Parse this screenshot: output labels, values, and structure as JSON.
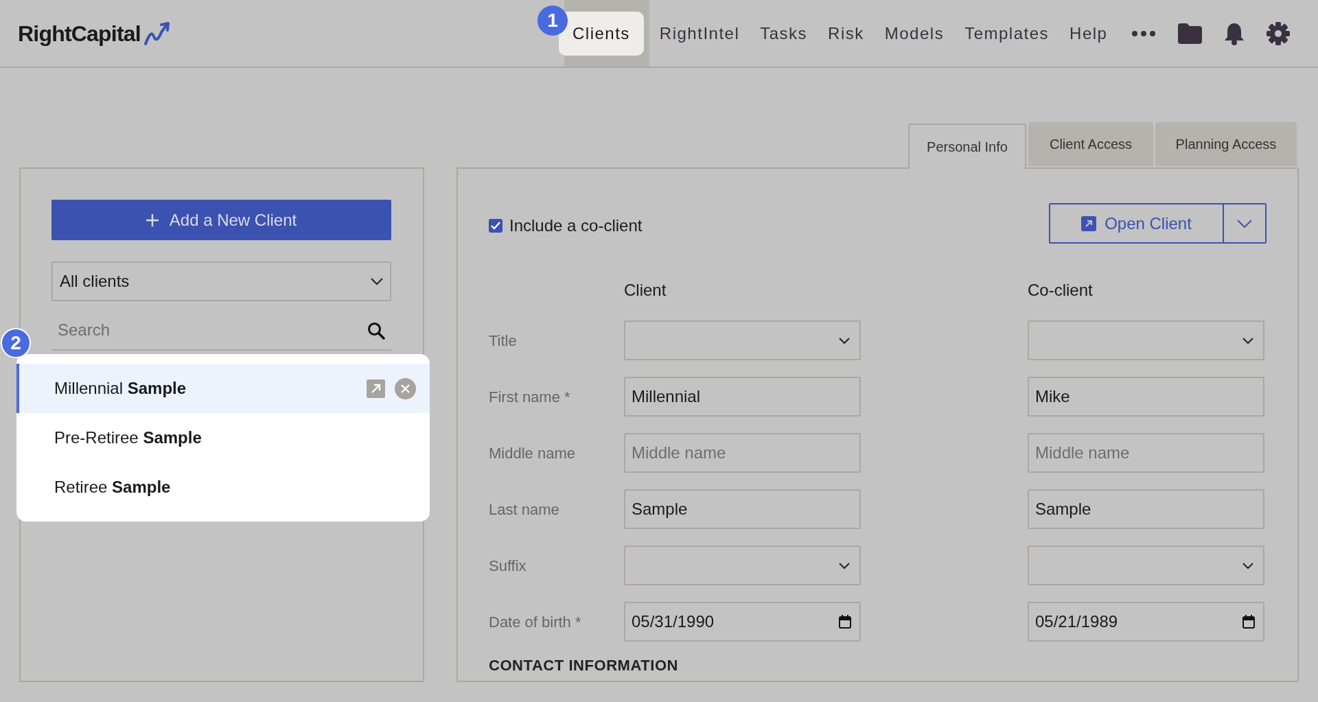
{
  "logo": "RightCapital",
  "nav": [
    {
      "label": "Clients",
      "selected": true,
      "badge": "1"
    },
    {
      "label": "RightIntel",
      "selected": false
    },
    {
      "label": "Tasks",
      "selected": false
    },
    {
      "label": "Risk",
      "selected": false
    },
    {
      "label": "Models",
      "selected": false
    },
    {
      "label": "Templates",
      "selected": false
    },
    {
      "label": "Help",
      "selected": false
    }
  ],
  "tabs": [
    {
      "label": "Personal Info",
      "selected": true
    },
    {
      "label": "Client Access",
      "selected": false
    },
    {
      "label": "Planning Access",
      "selected": false
    }
  ],
  "sidebar": {
    "add_button": "Add a New Client",
    "filter": "All clients",
    "search": {
      "placeholder": "Search"
    },
    "list_badge": "2",
    "clients": [
      {
        "name": "Millennial **Sample**",
        "selected": true
      },
      {
        "name": "Pre-Retiree **Sample**",
        "selected": false
      },
      {
        "name": "Retiree **Sample**",
        "selected": false
      }
    ]
  },
  "form": {
    "include_coclient": {
      "label": "Include a co-client",
      "checked": true
    },
    "open_button": "Open Client",
    "columns": [
      "Client",
      "Co-client"
    ],
    "rows": [
      {
        "label": "Title",
        "kind": "select",
        "client": {},
        "coclient": {}
      },
      {
        "label": "First name *",
        "kind": "text",
        "client": {
          "value": "Millennial"
        },
        "coclient": {
          "value": "Mike"
        }
      },
      {
        "label": "Middle name",
        "kind": "text",
        "client": {
          "placeholder": "Middle name"
        },
        "coclient": {
          "placeholder": "Middle name"
        }
      },
      {
        "label": "Last name",
        "kind": "text",
        "client": {
          "value": "Sample"
        },
        "coclient": {
          "value": "Sample"
        }
      },
      {
        "label": "Suffix",
        "kind": "select",
        "client": {},
        "coclient": {}
      },
      {
        "label": "Date of birth *",
        "kind": "date",
        "client": {
          "value": "05/31/1990"
        },
        "coclient": {
          "value": "05/21/1989"
        }
      }
    ],
    "section_heading": "CONTACT INFORMATION"
  }
}
